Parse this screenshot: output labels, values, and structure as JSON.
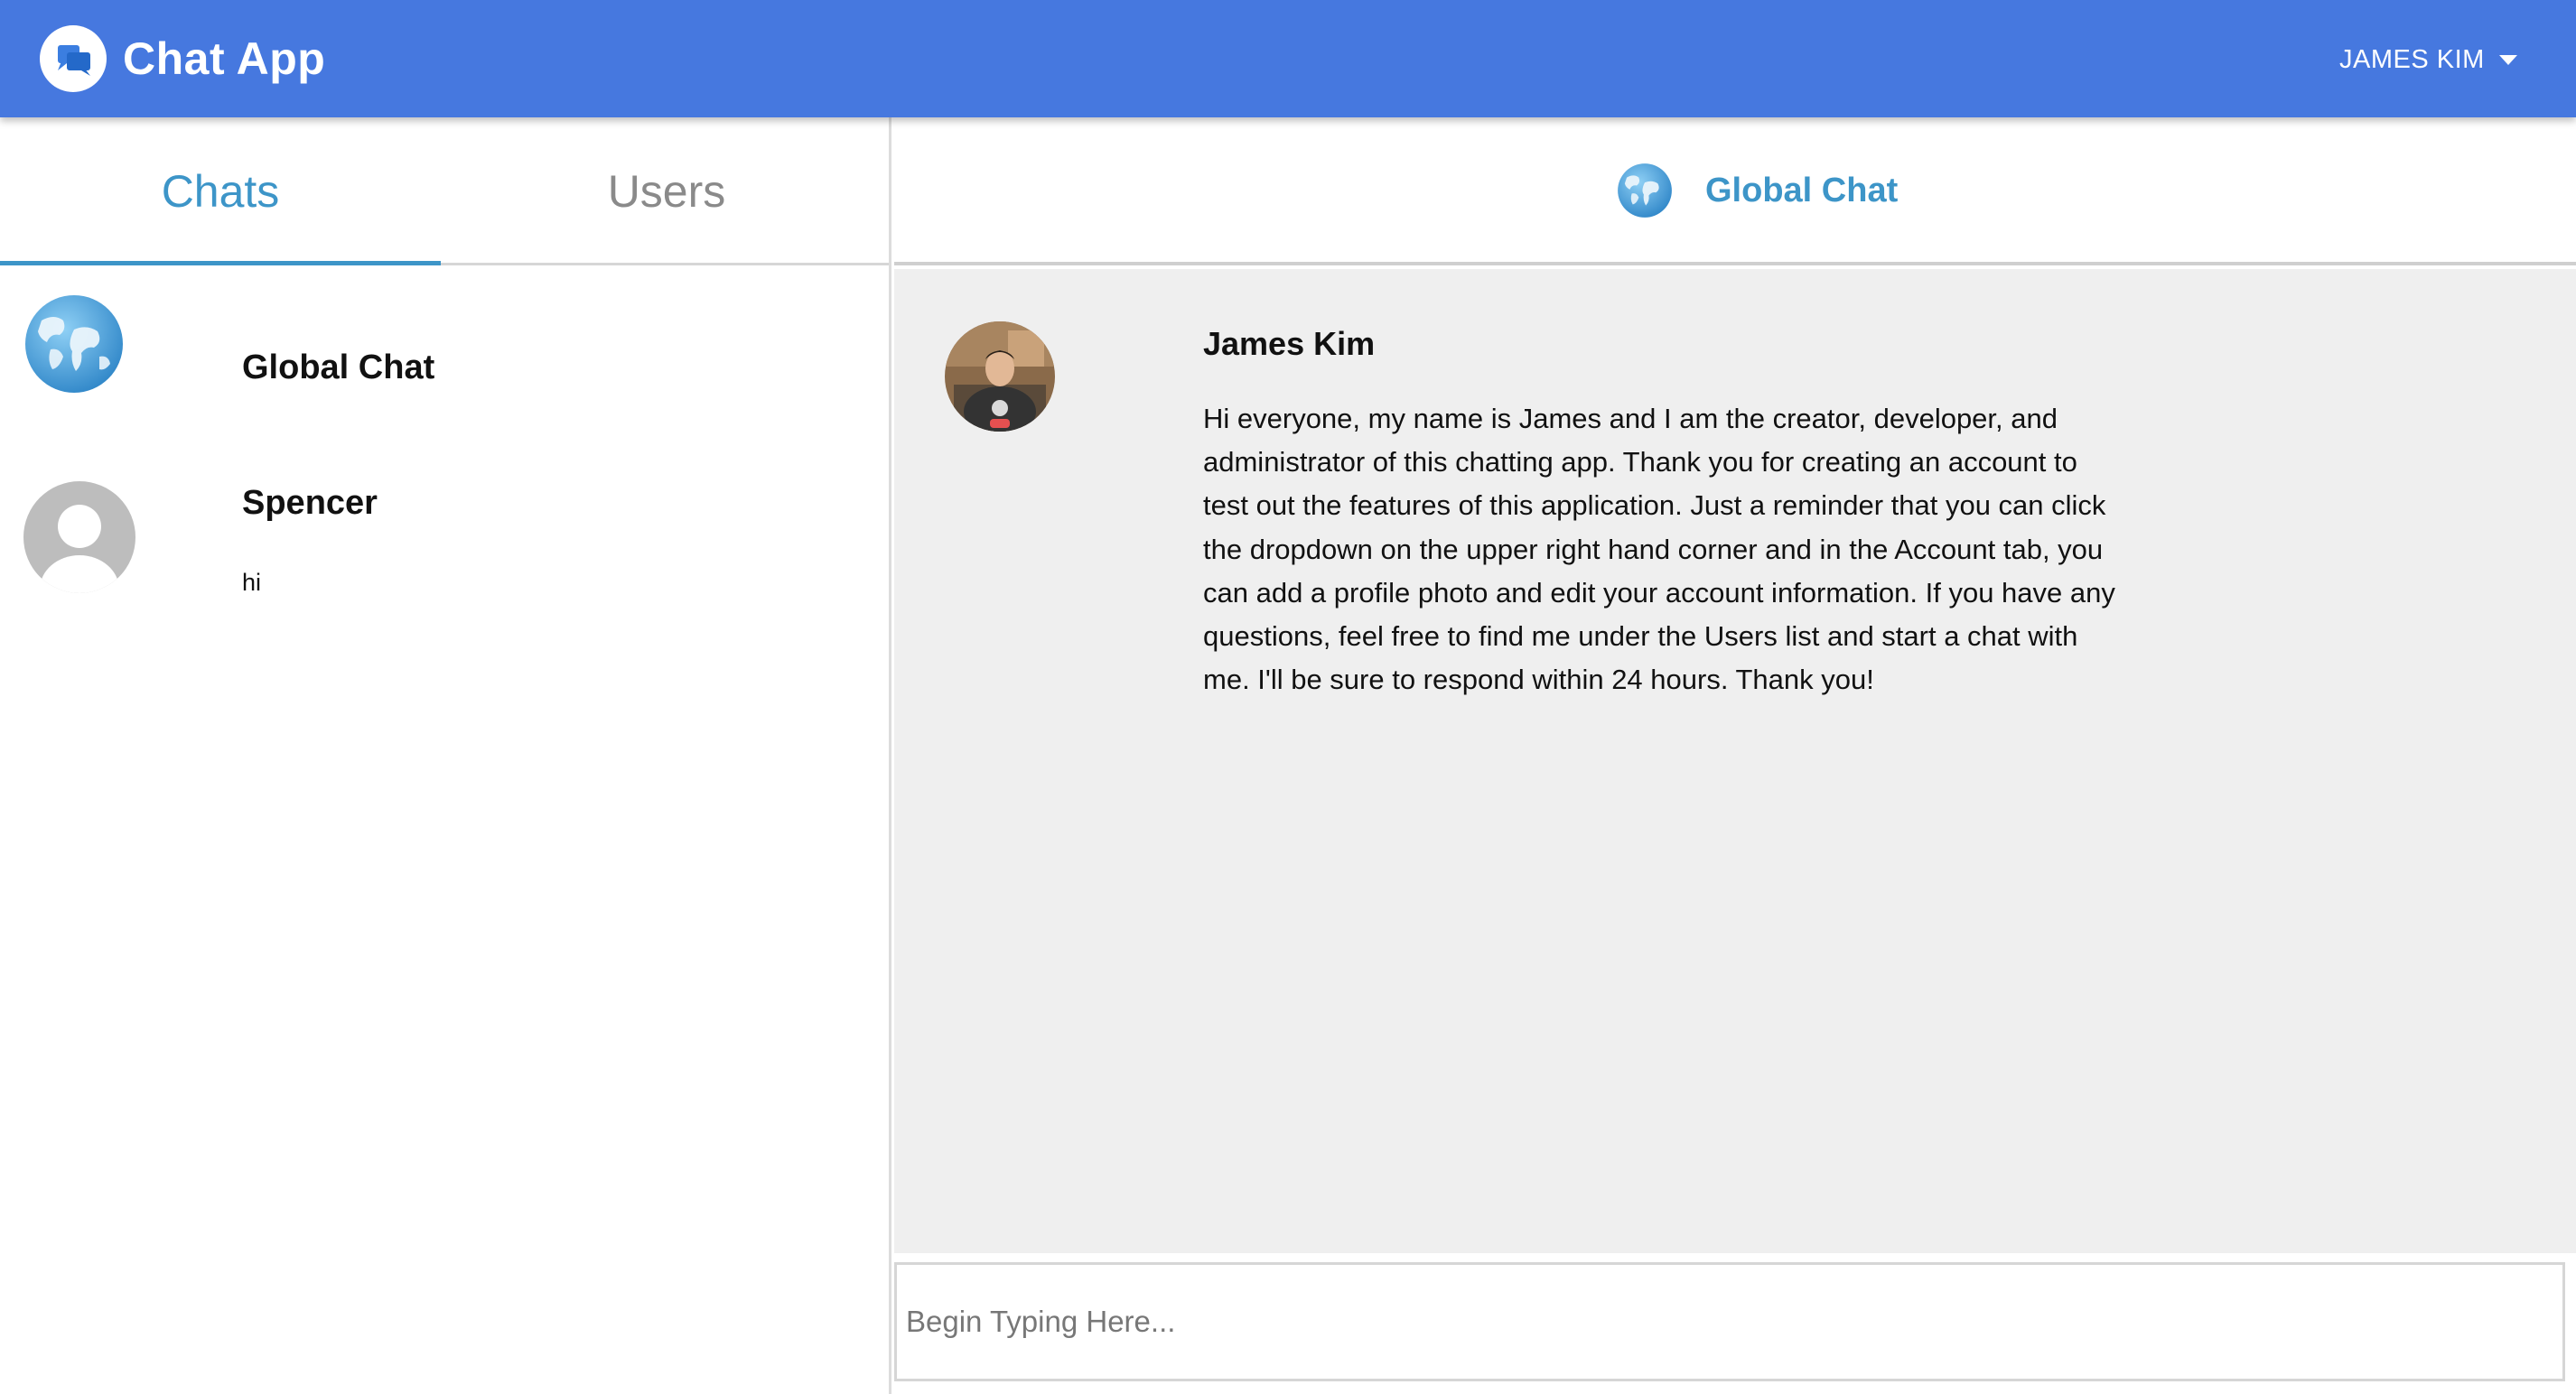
{
  "app": {
    "title": "Chat App",
    "brand_color": "#4678df",
    "accent_color": "#3d95c8"
  },
  "header": {
    "user_menu_label": "JAMES KIM",
    "user_menu_icon": "caret-down-icon"
  },
  "sidebar": {
    "tabs": [
      {
        "label": "Chats",
        "active": true
      },
      {
        "label": "Users",
        "active": false
      }
    ],
    "chats": [
      {
        "name": "Global Chat",
        "avatar": "globe-icon",
        "preview": ""
      },
      {
        "name": "Spencer",
        "avatar": "default-user-avatar",
        "preview": "hi"
      }
    ]
  },
  "conversation": {
    "title": "Global Chat",
    "icon": "globe-icon",
    "messages": [
      {
        "author": "James Kim",
        "avatar": "user-photo",
        "text": "Hi everyone, my name is James and I am the creator, developer, and administrator of this chatting app. Thank you for creating an account to test out the features of this application. Just a reminder that you can click the dropdown on the upper right hand corner and in the Account tab, you can add a profile photo and edit your account information. If you have any questions, feel free to find me under the Users list and start a chat with me. I'll be sure to respond within 24 hours. Thank you!"
      }
    ]
  },
  "composer": {
    "placeholder": "Begin Typing Here...",
    "value": ""
  }
}
